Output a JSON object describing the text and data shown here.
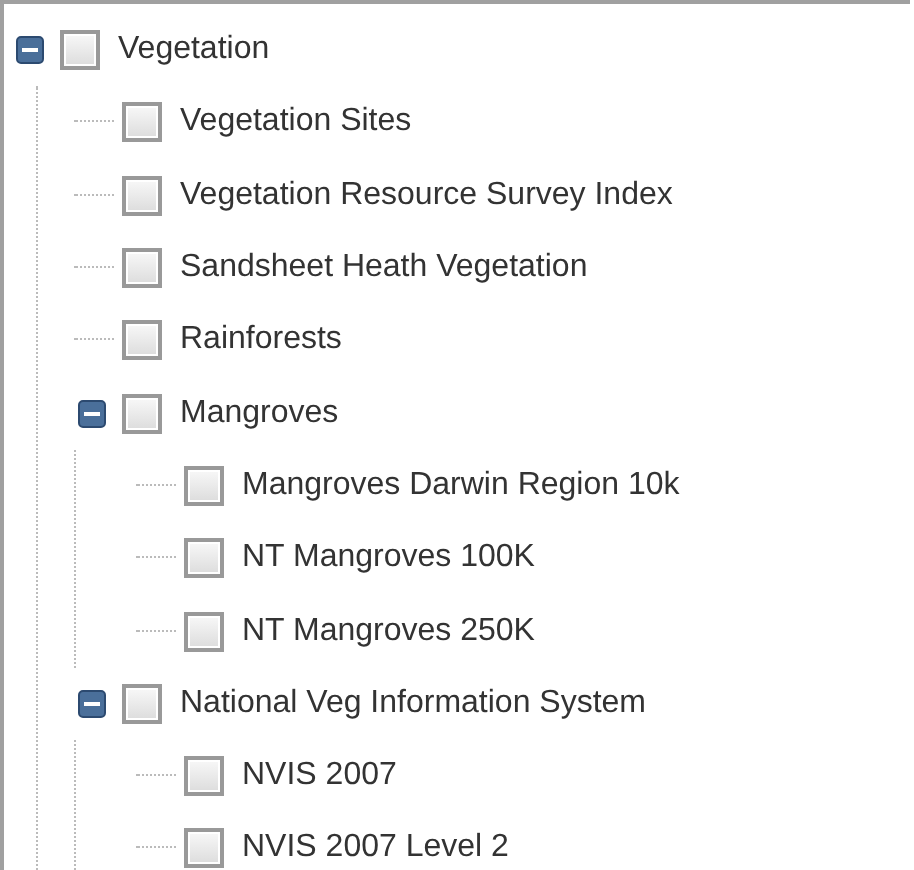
{
  "tree": [
    {
      "label": "Vegetation",
      "checked": false,
      "expanded": true,
      "children": [
        {
          "label": "Vegetation Sites",
          "checked": false
        },
        {
          "label": "Vegetation Resource Survey Index",
          "checked": false
        },
        {
          "label": "Sandsheet Heath Vegetation",
          "checked": false
        },
        {
          "label": "Rainforests",
          "checked": false
        },
        {
          "label": "Mangroves",
          "checked": false,
          "expanded": true,
          "children": [
            {
              "label": "Mangroves Darwin Region 10k",
              "checked": false
            },
            {
              "label": "NT Mangroves 100K",
              "checked": false
            },
            {
              "label": "NT Mangroves 250K",
              "checked": false
            }
          ]
        },
        {
          "label": "National Veg Information System",
          "checked": false,
          "expanded": true,
          "children": [
            {
              "label": "NVIS 2007",
              "checked": false
            },
            {
              "label": "NVIS 2007 Level 2",
              "checked": false
            }
          ]
        }
      ]
    }
  ]
}
